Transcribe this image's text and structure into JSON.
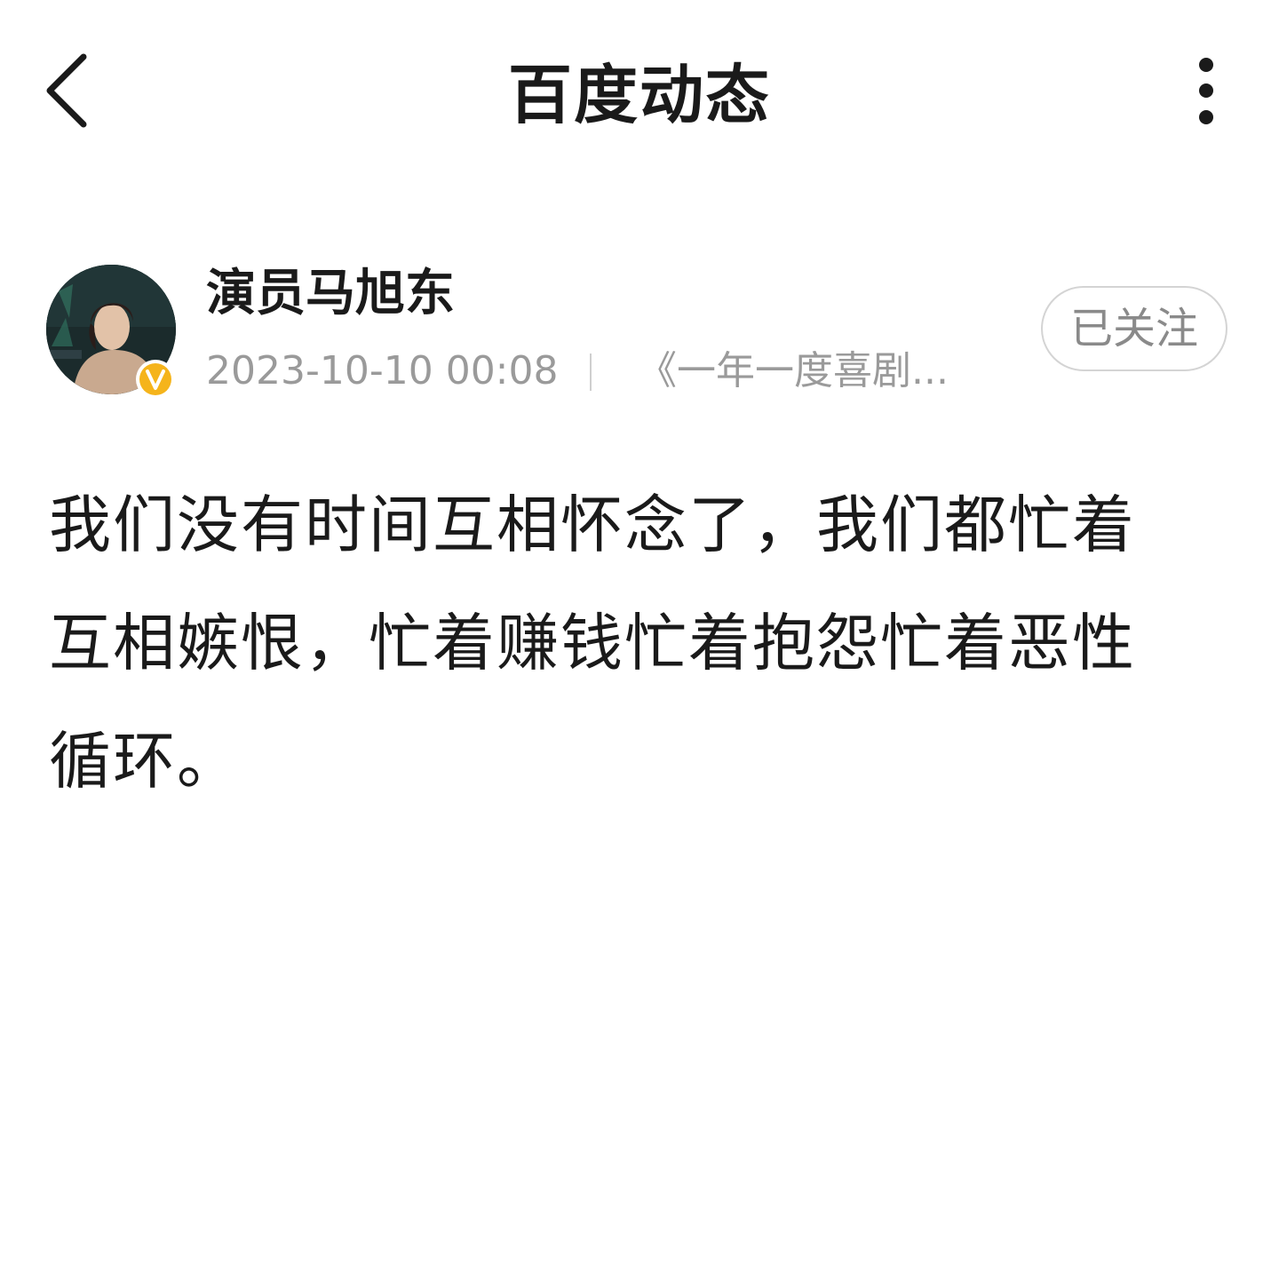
{
  "navbar": {
    "title": "百度动态",
    "back_icon": "chevron-left-icon",
    "more_icon": "more-vertical-icon"
  },
  "author": {
    "name": "演员马旭东",
    "verified_icon": "verified-v-badge-icon",
    "verified_color": "#F5B41B",
    "post_time": "2023-10-10 00:08",
    "source": "《一年一度喜剧...",
    "follow_label": "已关注"
  },
  "post": {
    "text": "我们没有时间互相怀念了，我们都忙着互相嫉恨，忙着赚钱忙着抱怨忙着恶性循环。"
  }
}
